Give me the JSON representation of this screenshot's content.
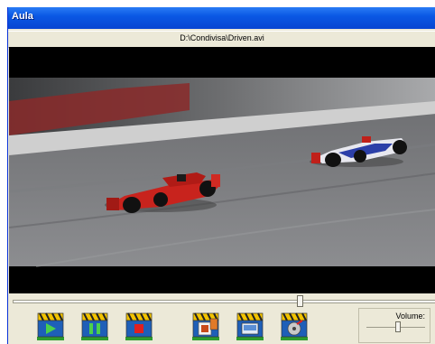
{
  "window": {
    "title": "Aula"
  },
  "file": {
    "path": "D:\\Condivisa\\Driven.avi"
  },
  "playback": {
    "position_fraction": 0.68
  },
  "toolbar": {
    "buttons": [
      {
        "icon": "play-icon"
      },
      {
        "icon": "pause-icon"
      },
      {
        "icon": "stop-icon"
      },
      {
        "icon": "capture-frame-icon"
      },
      {
        "icon": "fullscreen-icon"
      },
      {
        "icon": "open-file-icon"
      }
    ]
  },
  "volume": {
    "label": "Volume:",
    "level_fraction": 0.55
  },
  "colors": {
    "titlebar": "#0a58e4",
    "face": "#ece9d8",
    "slate_yellow": "#f2c300",
    "base_green": "#2e9c2e"
  }
}
